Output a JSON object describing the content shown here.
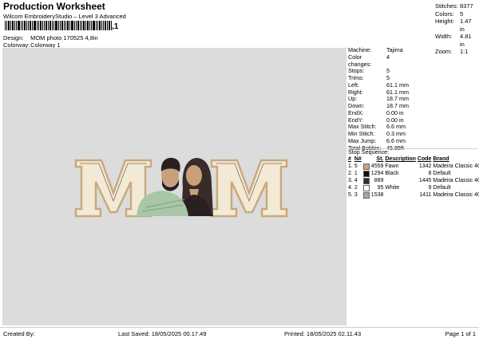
{
  "header": {
    "title": "Production Worksheet",
    "subtitle": "Wilcom EmbroideryStudio – Level 3 Advanced",
    "barcode_suffix": ",1"
  },
  "design_meta": {
    "design_label": "Design:",
    "design_value": "MOM photo 170525 4,8in",
    "colorway_label": "Colorway:",
    "colorway_value": "Colorway 1"
  },
  "stats": [
    {
      "label": "Stitches:",
      "value": "8377"
    },
    {
      "label": "Colors:",
      "value": "5"
    },
    {
      "label": "Height:",
      "value": "1.47 in"
    },
    {
      "label": "Width:",
      "value": "4.81 in"
    },
    {
      "label": "Zoom:",
      "value": "1:1"
    }
  ],
  "machine_info": [
    {
      "label": "Machine:",
      "value": "Tajima"
    },
    {
      "label": "Color changes:",
      "value": "4"
    },
    {
      "label": "Stops:",
      "value": "5"
    },
    {
      "label": "Trims:",
      "value": "5"
    },
    {
      "label": "Left:",
      "value": "61.1 mm"
    },
    {
      "label": "Right:",
      "value": "61.1 mm"
    },
    {
      "label": "Up:",
      "value": "18.7 mm"
    },
    {
      "label": "Down:",
      "value": "18.7 mm"
    },
    {
      "label": "EndX:",
      "value": "0.00 in"
    },
    {
      "label": "EndY:",
      "value": "0.00 in"
    },
    {
      "label": "Max Stitch:",
      "value": "6.6 mm"
    },
    {
      "label": "Min Stitch:",
      "value": "0.3 mm"
    },
    {
      "label": "Max Jump:",
      "value": "6.6 mm"
    },
    {
      "label": "Total Bobbin:",
      "value": "45.95ft"
    }
  ],
  "stop_sequence": {
    "title": "Stop Sequence:",
    "headers": [
      "#",
      "N#",
      "St.",
      "Description",
      "Code",
      "Brand"
    ],
    "rows": [
      {
        "num": "1.",
        "needle": "5",
        "color": "#c9a47c",
        "stitches": "4559",
        "desc": "Fawn",
        "code": "1342",
        "brand": "Madeira Classic 40"
      },
      {
        "num": "2.",
        "needle": "1",
        "color": "#111111",
        "stitches": "1294",
        "desc": "Black",
        "code": "8",
        "brand": "Default"
      },
      {
        "num": "3.",
        "needle": "4",
        "color": "#3a2b2b",
        "stitches": "889",
        "desc": "",
        "code": "1445",
        "brand": "Madeira Classic 40"
      },
      {
        "num": "4.",
        "needle": "2",
        "color": "#ffffff",
        "stitches": "95",
        "desc": "White",
        "code": "9",
        "brand": "Default"
      },
      {
        "num": "5.",
        "needle": "3",
        "color": "#a8a8a8",
        "stitches": "1538",
        "desc": "",
        "code": "1411",
        "brand": "Madeira Classic 40"
      }
    ]
  },
  "footer": {
    "created_by": "Created By:",
    "last_saved": "Last Saved: 18/05/2025 00.17.49",
    "printed": "Printed: 18/05/2025 02.11.43",
    "page": "Page 1 of 1"
  }
}
